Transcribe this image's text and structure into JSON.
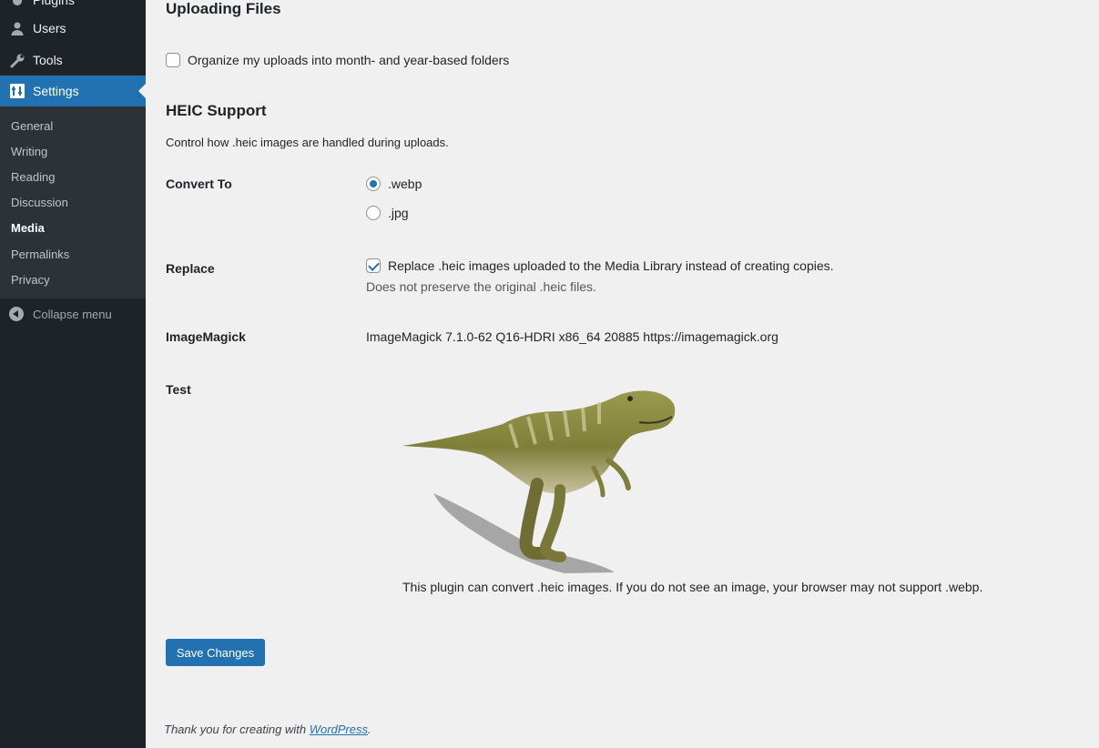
{
  "sidebar": {
    "top_items": [
      {
        "label": "Plugins",
        "icon": "plugin-icon"
      },
      {
        "label": "Users",
        "icon": "user-icon"
      },
      {
        "label": "Tools",
        "icon": "wrench-icon"
      },
      {
        "label": "Settings",
        "icon": "settings-icon"
      }
    ],
    "submenu": [
      "General",
      "Writing",
      "Reading",
      "Discussion",
      "Media",
      "Permalinks",
      "Privacy"
    ],
    "active_submenu": "Media",
    "collapse_label": "Collapse menu"
  },
  "uploading": {
    "heading": "Uploading Files",
    "organize_label": "Organize my uploads into month- and year-based folders",
    "organize_checked": false
  },
  "heic": {
    "heading": "HEIC Support",
    "description": "Control how .heic images are handled during uploads.",
    "convert_label": "Convert To",
    "options": [
      ".webp",
      ".jpg"
    ],
    "selected": ".webp",
    "replace_label": "Replace",
    "replace_text": "Replace .heic images uploaded to the Media Library instead of creating copies.",
    "replace_checked": true,
    "replace_note": "Does not preserve the original .heic files.",
    "imagemagick_label": "ImageMagick",
    "imagemagick_value": "ImageMagick 7.1.0-62 Q16-HDRI x86_64 20885 https://imagemagick.org",
    "test_label": "Test",
    "test_caption": "This plugin can convert .heic images. If you do not see an image, your browser may not support .webp."
  },
  "save_label": "Save Changes",
  "footer": {
    "text": "Thank you for creating with ",
    "link": "WordPress",
    "suffix": "."
  },
  "colors": {
    "accent": "#2271b1",
    "sidebar": "#1d2327",
    "background": "#f0f0f1"
  }
}
